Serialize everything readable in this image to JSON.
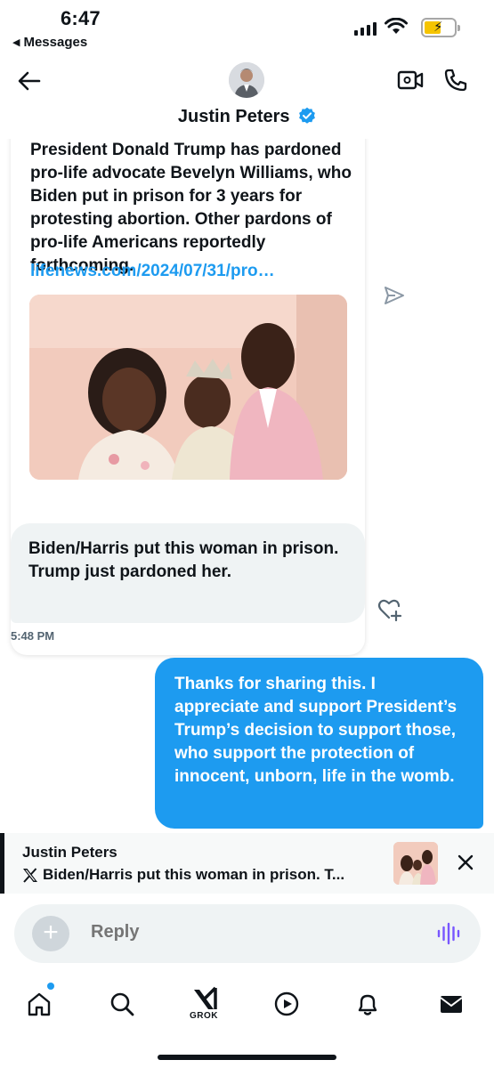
{
  "status_bar": {
    "time": "6:47",
    "back_app": "Messages",
    "battery_color": "#f5c400"
  },
  "header": {
    "contact_name": "Justin Peters",
    "verified": true,
    "icons": [
      "back-arrow-icon",
      "video-call-icon",
      "phone-icon"
    ]
  },
  "messages": {
    "shared_post": {
      "text": "President Donald Trump has pardoned pro-life advocate Bevelyn Williams, who Biden put in prison for 3 years for protesting abortion. Other pardons of pro-life Americans reportedly forthcoming.",
      "link": "lifenews.com/2024/07/31/pro…"
    },
    "incoming": {
      "text": "Biden/Harris put this woman in prison. Trump just pardoned her.",
      "time": "5:48 PM"
    },
    "outgoing": {
      "text": "Thanks for sharing this. I appreciate and support President’s Trump’s decision to support those, who support the protection of innocent, unborn, life in the womb."
    }
  },
  "reply_preview": {
    "name": "Justin Peters",
    "text": "Biden/Harris put this woman in prison. T..."
  },
  "composer": {
    "placeholder": "Reply"
  },
  "bottom_nav": {
    "grok_label": "GROK",
    "items": [
      "home-icon",
      "search-icon",
      "grok-icon",
      "video-icon",
      "notifications-icon",
      "messages-icon"
    ]
  },
  "colors": {
    "accent": "#1d9bf0",
    "bubble_in": "#eff3f4",
    "text": "#0f1419",
    "muted": "#536471"
  }
}
